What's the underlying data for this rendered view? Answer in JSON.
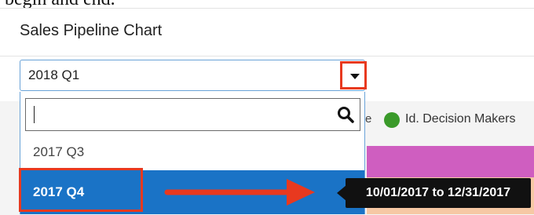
{
  "caption_fragment": "begin and end.",
  "card": {
    "title": "Sales Pipeline Chart"
  },
  "timeframe_select": {
    "value": "2018 Q1",
    "search_placeholder": "",
    "options": [
      {
        "label": "2017 Q3",
        "selected": false
      },
      {
        "label": "2017 Q4",
        "selected": true
      }
    ]
  },
  "legend": {
    "fragment": "e",
    "items": [
      {
        "label": "Id. Decision Makers",
        "color": "#3a9a2a"
      }
    ]
  },
  "tooltip": {
    "text": "10/01/2017 to 12/31/2017"
  },
  "colors": {
    "accent": "#1a73c6",
    "annotation_red": "#e8391f",
    "bar_purple": "#cf5ec0",
    "bar_orange": "#f6c8a4",
    "legend_green": "#3a9a2a"
  },
  "icons": {
    "dropdown": "caret-down-icon",
    "search": "search-icon"
  }
}
